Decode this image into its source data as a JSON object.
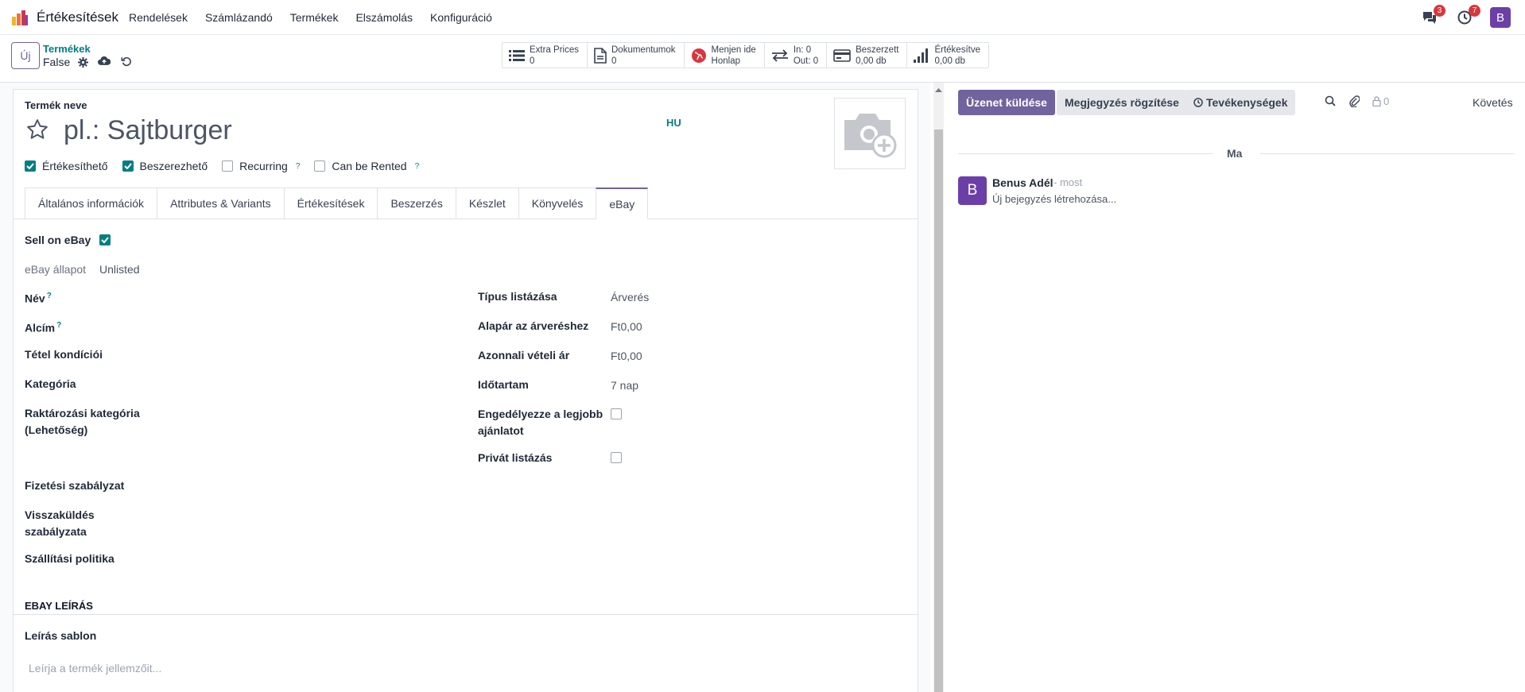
{
  "app": {
    "name": "Értékesítések"
  },
  "nav": {
    "menu": [
      "Rendelések",
      "Számlázandó",
      "Termékek",
      "Elszámolás",
      "Konfiguráció"
    ],
    "messages_count": "3",
    "activities_count": "7",
    "user_initial": "B"
  },
  "control": {
    "new_label": "Új",
    "breadcrumb": "Termékek",
    "record_name": "False"
  },
  "smart_buttons": [
    {
      "line1": "Extra Prices",
      "line2": "0",
      "icon": "list-icon"
    },
    {
      "line1": "Dokumentumok",
      "line2": "0",
      "icon": "document-icon"
    },
    {
      "line1": "Menjen ide",
      "line2": "Honlap",
      "icon": "globe-icon"
    },
    {
      "line1": "In: 0",
      "line2": "Out: 0",
      "icon": "transfer-icon"
    },
    {
      "line1": "Beszerzett",
      "line2": "0,00 db",
      "icon": "credit-card-icon"
    },
    {
      "line1": "Értékesítve",
      "line2": "0,00 db",
      "icon": "signal-icon"
    }
  ],
  "product": {
    "name_label": "Termék neve",
    "name_placeholder": "pl.: Sajtburger",
    "lang": "HU",
    "checks": [
      {
        "label": "Értékesíthető",
        "checked": true,
        "help": false
      },
      {
        "label": "Beszerezhető",
        "checked": true,
        "help": false
      },
      {
        "label": "Recurring",
        "checked": false,
        "help": true
      },
      {
        "label": "Can be Rented",
        "checked": false,
        "help": true
      }
    ]
  },
  "tabs": [
    "Általános információk",
    "Attributes & Variants",
    "Értékesítések",
    "Beszerzés",
    "Készlet",
    "Könyvelés",
    "eBay"
  ],
  "ebay": {
    "sell_label": "Sell on eBay",
    "status_label": "eBay állapot",
    "status_value": "Unlisted",
    "left_fields": {
      "name": "Név",
      "subtitle": "Alcím",
      "condition": "Tétel kondíciói",
      "category": "Kategória",
      "store_category_1": "Raktározási kategória",
      "store_category_2": "(Lehetőség)",
      "payment": "Fizetési szabályzat",
      "return_1": "Visszaküldés",
      "return_2": "szabályzata",
      "shipping": "Szállítási politika"
    },
    "right_fields": {
      "listing_type_label": "Típus listázása",
      "listing_type_value": "Árverés",
      "start_price_label": "Alapár az árveréshez",
      "start_price_value": "Ft0,00",
      "buy_now_label": "Azonnali vételi ár",
      "buy_now_value": "Ft0,00",
      "duration_label": "Időtartam",
      "duration_value": "7 nap",
      "best_offer_1": "Engedélyezze a legjobb",
      "best_offer_2": "ajánlatot",
      "private_label": "Privát listázás"
    },
    "description_title": "EBAY LEÍRÁS",
    "template_label": "Leírás sablon",
    "description_placeholder": "Leírja a termék jellemzőit..."
  },
  "chatter": {
    "send_label": "Üzenet küldése",
    "note_label": "Megjegyzés rögzítése",
    "activities_label": "Tevékenységek",
    "followers_count": "0",
    "follow_label": "Követés",
    "day_label": "Ma",
    "message": {
      "avatar": "B",
      "author": "Benus Adél",
      "time": "- most",
      "body": "Új bejegyzés létrehozása..."
    }
  }
}
